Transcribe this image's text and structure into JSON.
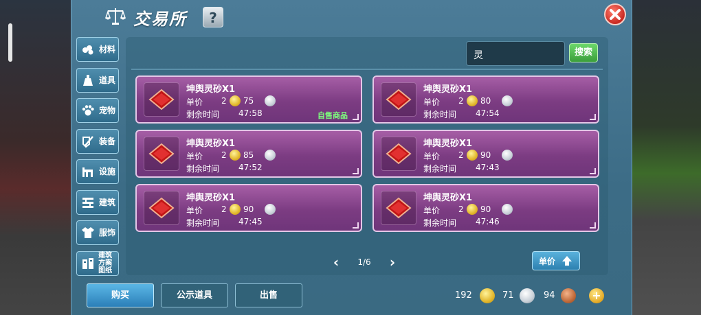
{
  "header": {
    "title": "交易所",
    "help": "?"
  },
  "nav": [
    {
      "label": "材料",
      "icon": "material-icon"
    },
    {
      "label": "道具",
      "icon": "potion-icon"
    },
    {
      "label": "宠物",
      "icon": "paw-icon"
    },
    {
      "label": "装备",
      "icon": "equipment-icon"
    },
    {
      "label": "设施",
      "icon": "facility-icon"
    },
    {
      "label": "建筑",
      "icon": "building-icon"
    },
    {
      "label": "服饰",
      "icon": "clothing-icon"
    },
    {
      "label": "建筑方案图纸",
      "icon": "blueprint-icon"
    }
  ],
  "search": {
    "value": "灵",
    "button": "搜索"
  },
  "labels": {
    "price": "单价",
    "time": "剩余时间"
  },
  "items": [
    {
      "name": "坤舆灵砂X1",
      "gold": "2",
      "silver": "75",
      "time": "47:58",
      "tag": "自售商品"
    },
    {
      "name": "坤舆灵砂X1",
      "gold": "2",
      "silver": "80",
      "time": "47:54",
      "tag": ""
    },
    {
      "name": "坤舆灵砂X1",
      "gold": "2",
      "silver": "85",
      "time": "47:52",
      "tag": ""
    },
    {
      "name": "坤舆灵砂X1",
      "gold": "2",
      "silver": "90",
      "time": "47:43",
      "tag": ""
    },
    {
      "name": "坤舆灵砂X1",
      "gold": "2",
      "silver": "90",
      "time": "47:45",
      "tag": ""
    },
    {
      "name": "坤舆灵砂X1",
      "gold": "2",
      "silver": "90",
      "time": "47:46",
      "tag": ""
    }
  ],
  "pager": {
    "text": "1/6"
  },
  "sort": {
    "label": "单价"
  },
  "buttons": {
    "buy": "购买",
    "public": "公示道具",
    "sell": "出售"
  },
  "currency": {
    "gold": "192",
    "silver": "71",
    "copper": "94"
  },
  "colors": {
    "panel": "#4c7c98",
    "card": "#7c3c82",
    "accent_green": "#3a9e3a",
    "gold": "#e2b72c"
  }
}
